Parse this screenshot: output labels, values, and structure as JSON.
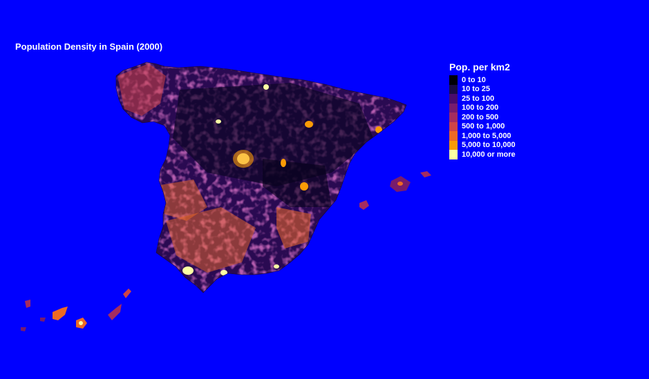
{
  "title": "Population Density in Spain (2000)",
  "legend": {
    "title": "Pop. per km2",
    "classes": [
      {
        "label": "0 to 10",
        "color": "#000004"
      },
      {
        "label": "10 to 25",
        "color": "#1b0c41"
      },
      {
        "label": "25 to 100",
        "color": "#4a0c6b"
      },
      {
        "label": "100 to 200",
        "color": "#781c6d"
      },
      {
        "label": "200 to 500",
        "color": "#a52c60"
      },
      {
        "label": "500 to 1,000",
        "color": "#cf4446"
      },
      {
        "label": "1,000 to 5,000",
        "color": "#ed6925"
      },
      {
        "label": "5,000 to 10,000",
        "color": "#fb9b06"
      },
      {
        "label": "10,000 or more",
        "color": "#fcffa4"
      }
    ]
  },
  "colors": {
    "background": "#0000ff",
    "text": "#ffffff"
  }
}
